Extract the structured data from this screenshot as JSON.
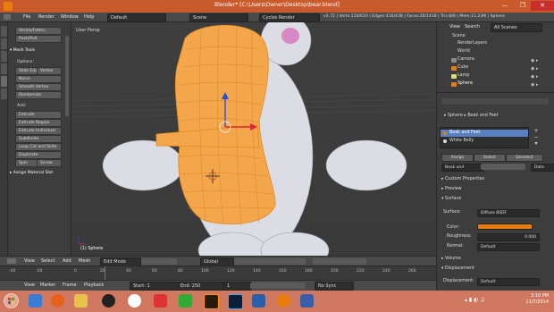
{
  "window": {
    "title": "Blender* [C:\\Users\\Owner\\Desktop\\bear.blend]",
    "min": "—",
    "max": "❐",
    "close": "✕"
  },
  "infobar": {
    "menus": [
      "File",
      "Render",
      "Window",
      "Help"
    ],
    "layout": "Default",
    "scene": "Scene",
    "engine": "Cycles Render",
    "stats": "v2.72 | Verts:134/610 | Edges:416/438 | Faces:20/1418 | Tris:8/8 | Mem:11.23M | Sphere"
  },
  "toolshelf": {
    "top_buttons": [
      "Shrink/Fatten",
      "Push/Pull"
    ],
    "mesh_tools_header": "Mesh Tools",
    "options_label": "Options:",
    "buttons": [
      [
        "Slide Edge",
        "Vertex"
      ],
      [
        "Noise"
      ],
      [
        "Smooth Vertex"
      ],
      [
        "Randomize"
      ]
    ],
    "add_label": "Add:",
    "add_buttons": [
      "Extrude",
      "Extrude Region",
      "Extrude Individual",
      "Subdivide",
      "Loop Cut and Slide",
      "Duplicate"
    ],
    "spin": "Spin",
    "screw": "Screw",
    "assign_material": "Assign Material Slot"
  },
  "viewport": {
    "label": "User Persp",
    "object_label": "(1) Sphere"
  },
  "vpheader": {
    "view": "View",
    "select": "Select",
    "add": "Add",
    "mesh": "Mesh",
    "mode": "Edit Mode",
    "pivot": "Global"
  },
  "timeline": {
    "ticks": [
      "-40",
      "-20",
      "0",
      "20",
      "40",
      "60",
      "80",
      "100",
      "120",
      "140",
      "160",
      "180",
      "200",
      "220",
      "240",
      "260"
    ],
    "view": "View",
    "marker": "Marker",
    "frame": "Frame",
    "playback": "Playback",
    "start": "Start:",
    "start_val": "1",
    "end": "End:",
    "end_val": "250",
    "current": "1",
    "sync": "No Sync"
  },
  "outliner": {
    "view": "View",
    "search": "Search",
    "filter": "All Scenes",
    "items": [
      "Scene",
      "RenderLayers",
      "World",
      "Camera",
      "Cube",
      "Lamp",
      "Sphere"
    ]
  },
  "properties": {
    "object_name": "Sphere",
    "material_name": "Beak and Feet",
    "slots": [
      "Beak and Feet",
      "White Belly"
    ],
    "assign": "Assign",
    "select": "Select",
    "deselect": "Deselect",
    "mat_field": "Beak and",
    "data_label": "Data",
    "custom_props": "Custom Properties",
    "preview": "Preview",
    "surface_head": "Surface",
    "surface_label": "Surface:",
    "surface_val": "Diffuse BSDF",
    "color_label": "Color:",
    "roughness_label": "Roughness:",
    "roughness_val": "0.000",
    "normal_label": "Normal:",
    "normal_val": "Default",
    "volume_head": "Volume",
    "displacement_head": "Displacement",
    "displacement_label": "Displacement:",
    "displacement_val": "Default"
  },
  "taskbar": {
    "time": "3:10 PM",
    "date": "11/7/2014"
  },
  "colors": {
    "accent": "#e87d0d",
    "title_bar": "#c85a2c",
    "taskbar": "#d0785f",
    "selected_slot": "#5680c2",
    "mesh_orange": "#f4a64a"
  }
}
